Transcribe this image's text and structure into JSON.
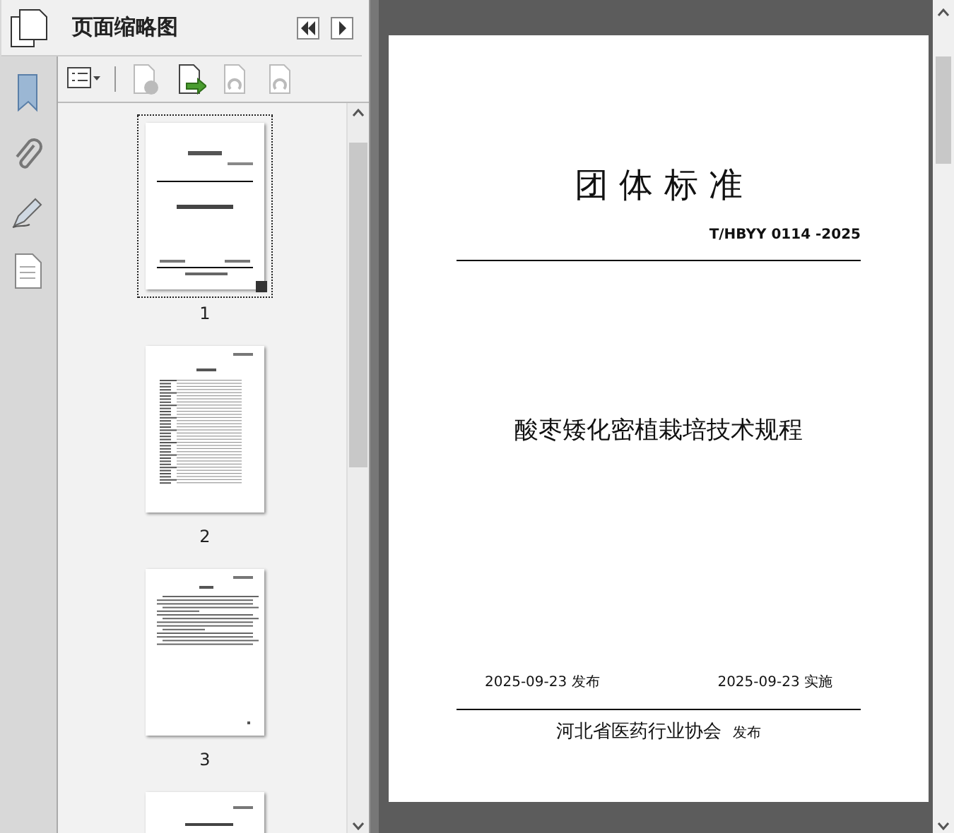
{
  "panel": {
    "title": "页面缩略图"
  },
  "toolbar": [
    {
      "kind": "options",
      "disabled": false
    },
    {
      "kind": "delete",
      "disabled": true
    },
    {
      "kind": "insert",
      "disabled": false
    },
    {
      "kind": "undo",
      "disabled": true
    },
    {
      "kind": "redo",
      "disabled": true
    }
  ],
  "rail": [
    {
      "kind": "bookmark",
      "selected": false
    },
    {
      "kind": "attachment",
      "selected": false
    },
    {
      "kind": "signature",
      "selected": false
    },
    {
      "kind": "page",
      "selected": false
    }
  ],
  "thumbnails": [
    {
      "kind": "cover",
      "page_label": "1",
      "selected": true
    },
    {
      "kind": "toc",
      "page_label": "2",
      "selected": false
    },
    {
      "kind": "text",
      "page_label": "3",
      "selected": false
    },
    {
      "kind": "chapter",
      "selected": false
    }
  ],
  "document": {
    "heading": "团 体 标 准",
    "code": "T/HBYY 0114 -2025",
    "title": "酸枣矮化密植栽培技术规程",
    "issue_date": "2025-09-23 发布",
    "effective_date": "2025-09-23 实施",
    "publisher": "河北省医药行业协会",
    "publisher_suffix": "发布"
  }
}
